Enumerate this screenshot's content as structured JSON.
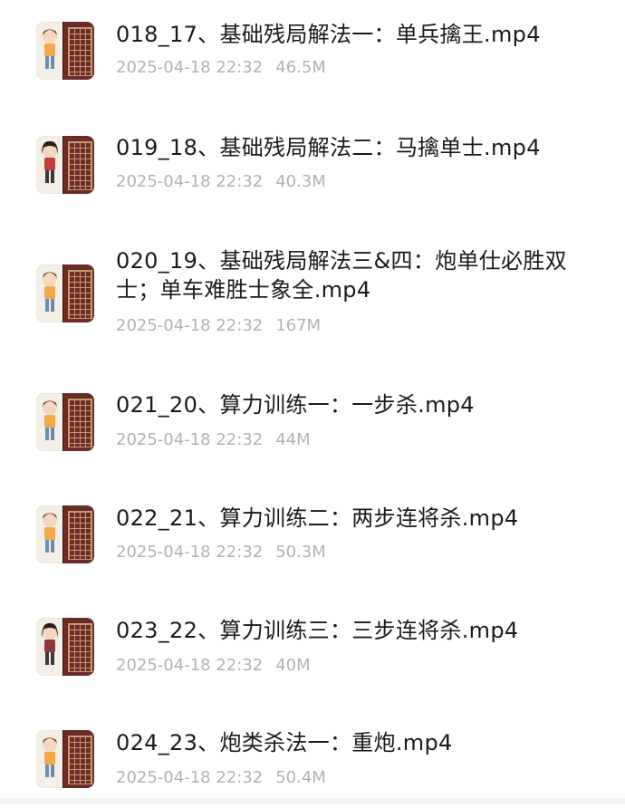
{
  "files": [
    {
      "name": "018_17、基础残局解法一：单兵擒王.mp4",
      "date": "2025-04-18 22:32",
      "size": "46.5M",
      "thumb_hair": "#5a3b2a",
      "thumb_shirt": "#f1a949"
    },
    {
      "name": "019_18、基础残局解法二：马擒单士.mp4",
      "date": "2025-04-18 22:32",
      "size": "40.3M",
      "thumb_hair": "#2b1e1a",
      "thumb_shirt": "#c23b3b"
    },
    {
      "name": "020_19、基础残局解法三&四：炮单仕必胜双士；单车难胜士象全.mp4",
      "date": "2025-04-18 22:32",
      "size": "167M",
      "thumb_hair": "#5a3b2a",
      "thumb_shirt": "#f1a949"
    },
    {
      "name": "021_20、算力训练一：一步杀.mp4",
      "date": "2025-04-18 22:32",
      "size": "44M",
      "thumb_hair": "#5a3b2a",
      "thumb_shirt": "#f1a949"
    },
    {
      "name": "022_21、算力训练二：两步连将杀.mp4",
      "date": "2025-04-18 22:32",
      "size": "50.3M",
      "thumb_hair": "#5a3b2a",
      "thumb_shirt": "#f1a949"
    },
    {
      "name": "023_22、算力训练三：三步连将杀.mp4",
      "date": "2025-04-18 22:32",
      "size": "40M",
      "thumb_hair": "#2b1e1a",
      "thumb_shirt": "#8b3a3a"
    },
    {
      "name": "024_23、炮类杀法一：重炮.mp4",
      "date": "2025-04-18 22:32",
      "size": "50.4M",
      "thumb_hair": "#5a3b2a",
      "thumb_shirt": "#f1a949"
    }
  ]
}
